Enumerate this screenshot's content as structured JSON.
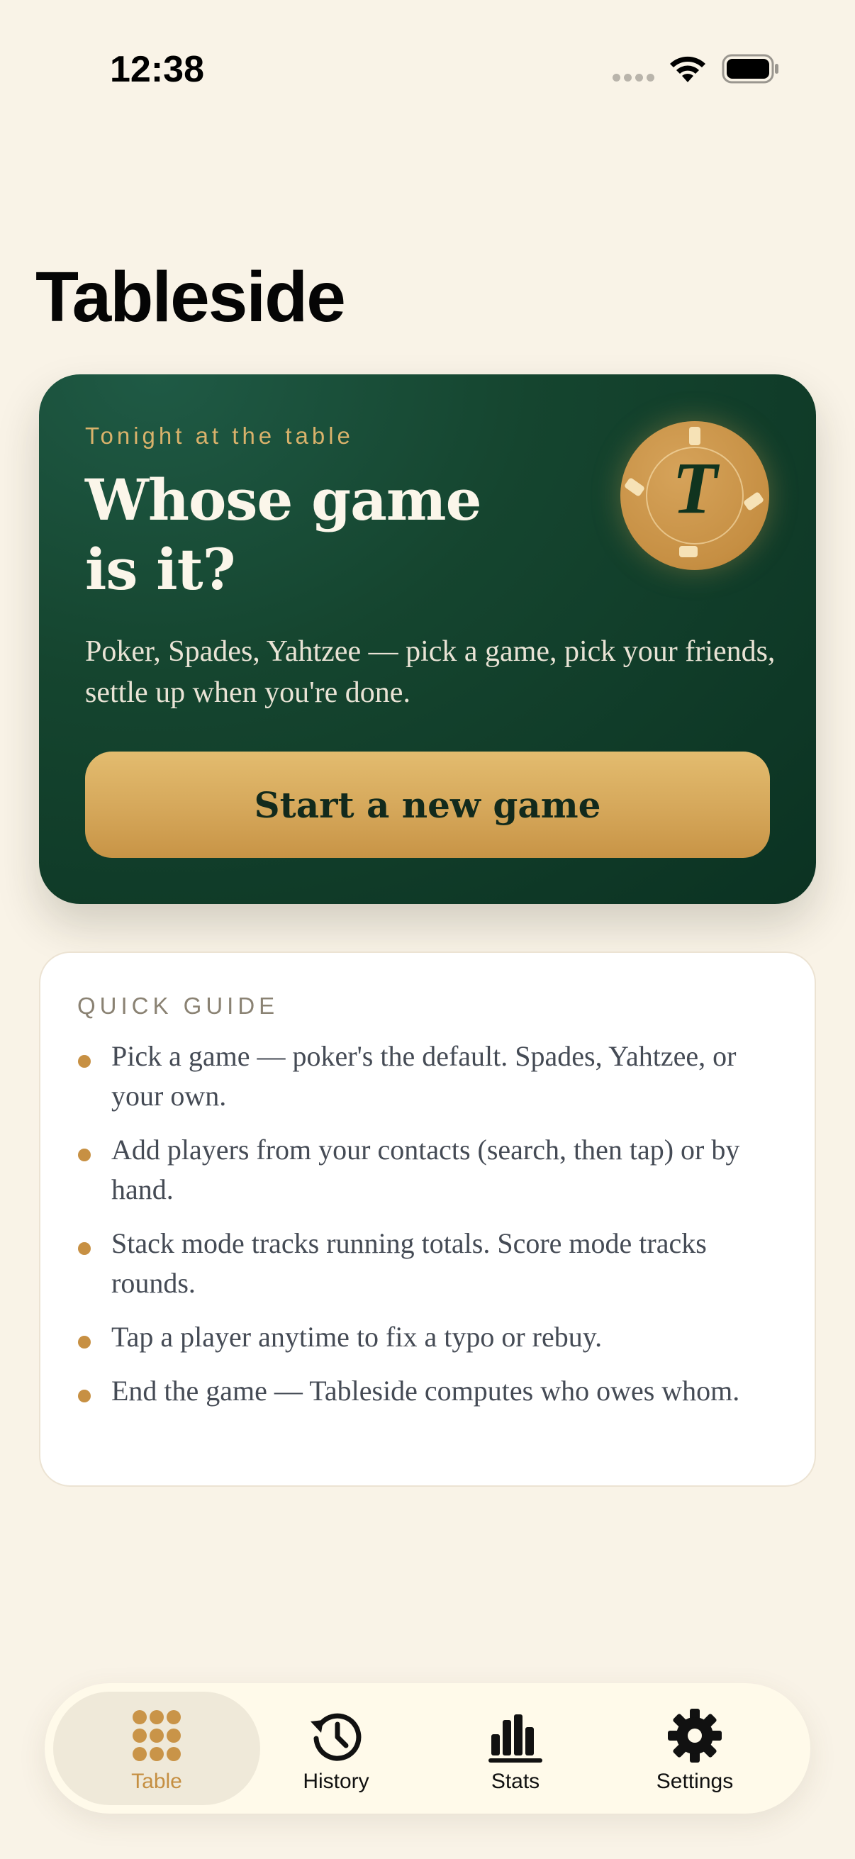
{
  "status_bar": {
    "time": "12:38"
  },
  "page": {
    "title": "Tableside"
  },
  "hero": {
    "eyebrow": "Tonight at the table",
    "title": "Whose game is it?",
    "description": "Poker, Spades, Yahtzee — pick a game, pick your friends, settle up when you're done.",
    "chip_letter": "T",
    "button_label": "Start a new game"
  },
  "guide": {
    "heading": "QUICK GUIDE",
    "items": [
      "Pick a game — poker's the default. Spades, Yahtzee, or your own.",
      "Add players from your contacts (search, then tap) or by hand.",
      "Stack mode tracks running totals. Score mode tracks rounds.",
      "Tap a player anytime to fix a typo or rebuy.",
      "End the game — Tableside computes who owes whom."
    ]
  },
  "tabbar": {
    "tabs": [
      {
        "label": "Table",
        "icon": "grid-dots-icon",
        "active": true
      },
      {
        "label": "History",
        "icon": "clock-history-icon",
        "active": false
      },
      {
        "label": "Stats",
        "icon": "bar-chart-icon",
        "active": false
      },
      {
        "label": "Settings",
        "icon": "gear-icon",
        "active": false
      }
    ]
  },
  "colors": {
    "background": "#f9f3e7",
    "hero_green": "#15452f",
    "gold": "#d5a75a",
    "active_tab": "#c58f42"
  }
}
